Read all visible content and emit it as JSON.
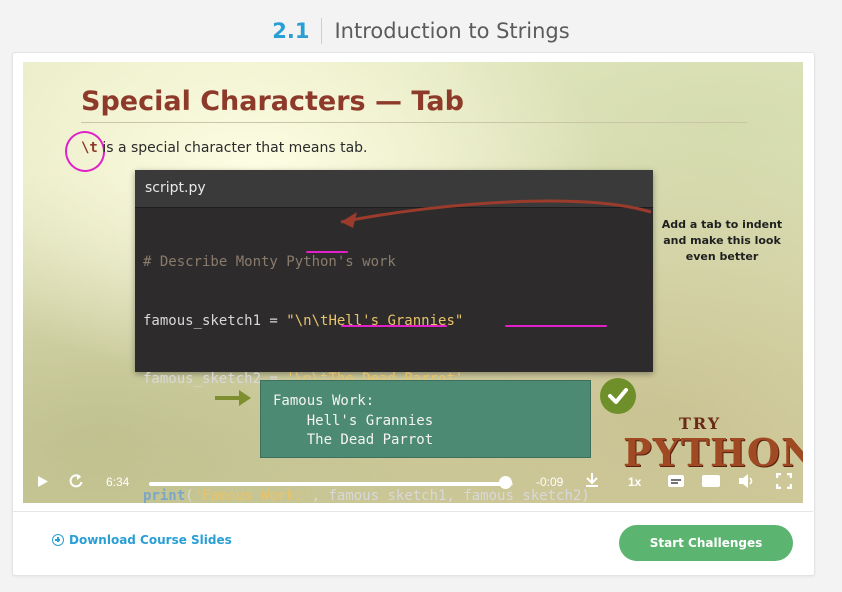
{
  "header": {
    "section_number": "2.1",
    "section_title": "Introduction to Strings"
  },
  "slide": {
    "title": "Special Characters — Tab",
    "escape_tag": "\\t",
    "description": "is a special character that means tab.",
    "editor_filename": "script.py",
    "code_lines": {
      "comment": "# Describe Monty Python's work",
      "line1_var": "famous_sketch1 = ",
      "line1_str": "\"\\n\\tHell's Grannies\"",
      "line2_var": "famous_sketch2 = ",
      "line2_str": "'\\n\\tThe Dead Parrot'",
      "print_kw": "print",
      "print_open": "(",
      "print_str": "'Famous Work:'",
      "print_rest": ", famous_sketch1, famous_sketch2)"
    },
    "annotation": "Add a tab to indent and make this look even better",
    "output_lines": [
      "Famous Work:",
      "    Hell's Grannies",
      "    The Dead Parrot"
    ],
    "logo_top": "TRY",
    "logo_bottom": "PYTHON"
  },
  "player": {
    "current_time": "6:34",
    "remaining_time": "-0:09",
    "speed": "1x",
    "progress_fraction": 0.977,
    "icons": [
      "play-icon",
      "replay-icon",
      "download-icon",
      "captions-icon",
      "hd-icon",
      "volume-icon",
      "fullscreen-icon"
    ]
  },
  "footer": {
    "download_label": "Download Course Slides",
    "start_button": "Start Challenges"
  },
  "colors": {
    "accent_blue": "#2a9fd6",
    "start_green": "#5bb46f",
    "slide_title": "#8e3a2a",
    "annotation_pink": "#e020c8",
    "output_green": "#4d8a73"
  }
}
